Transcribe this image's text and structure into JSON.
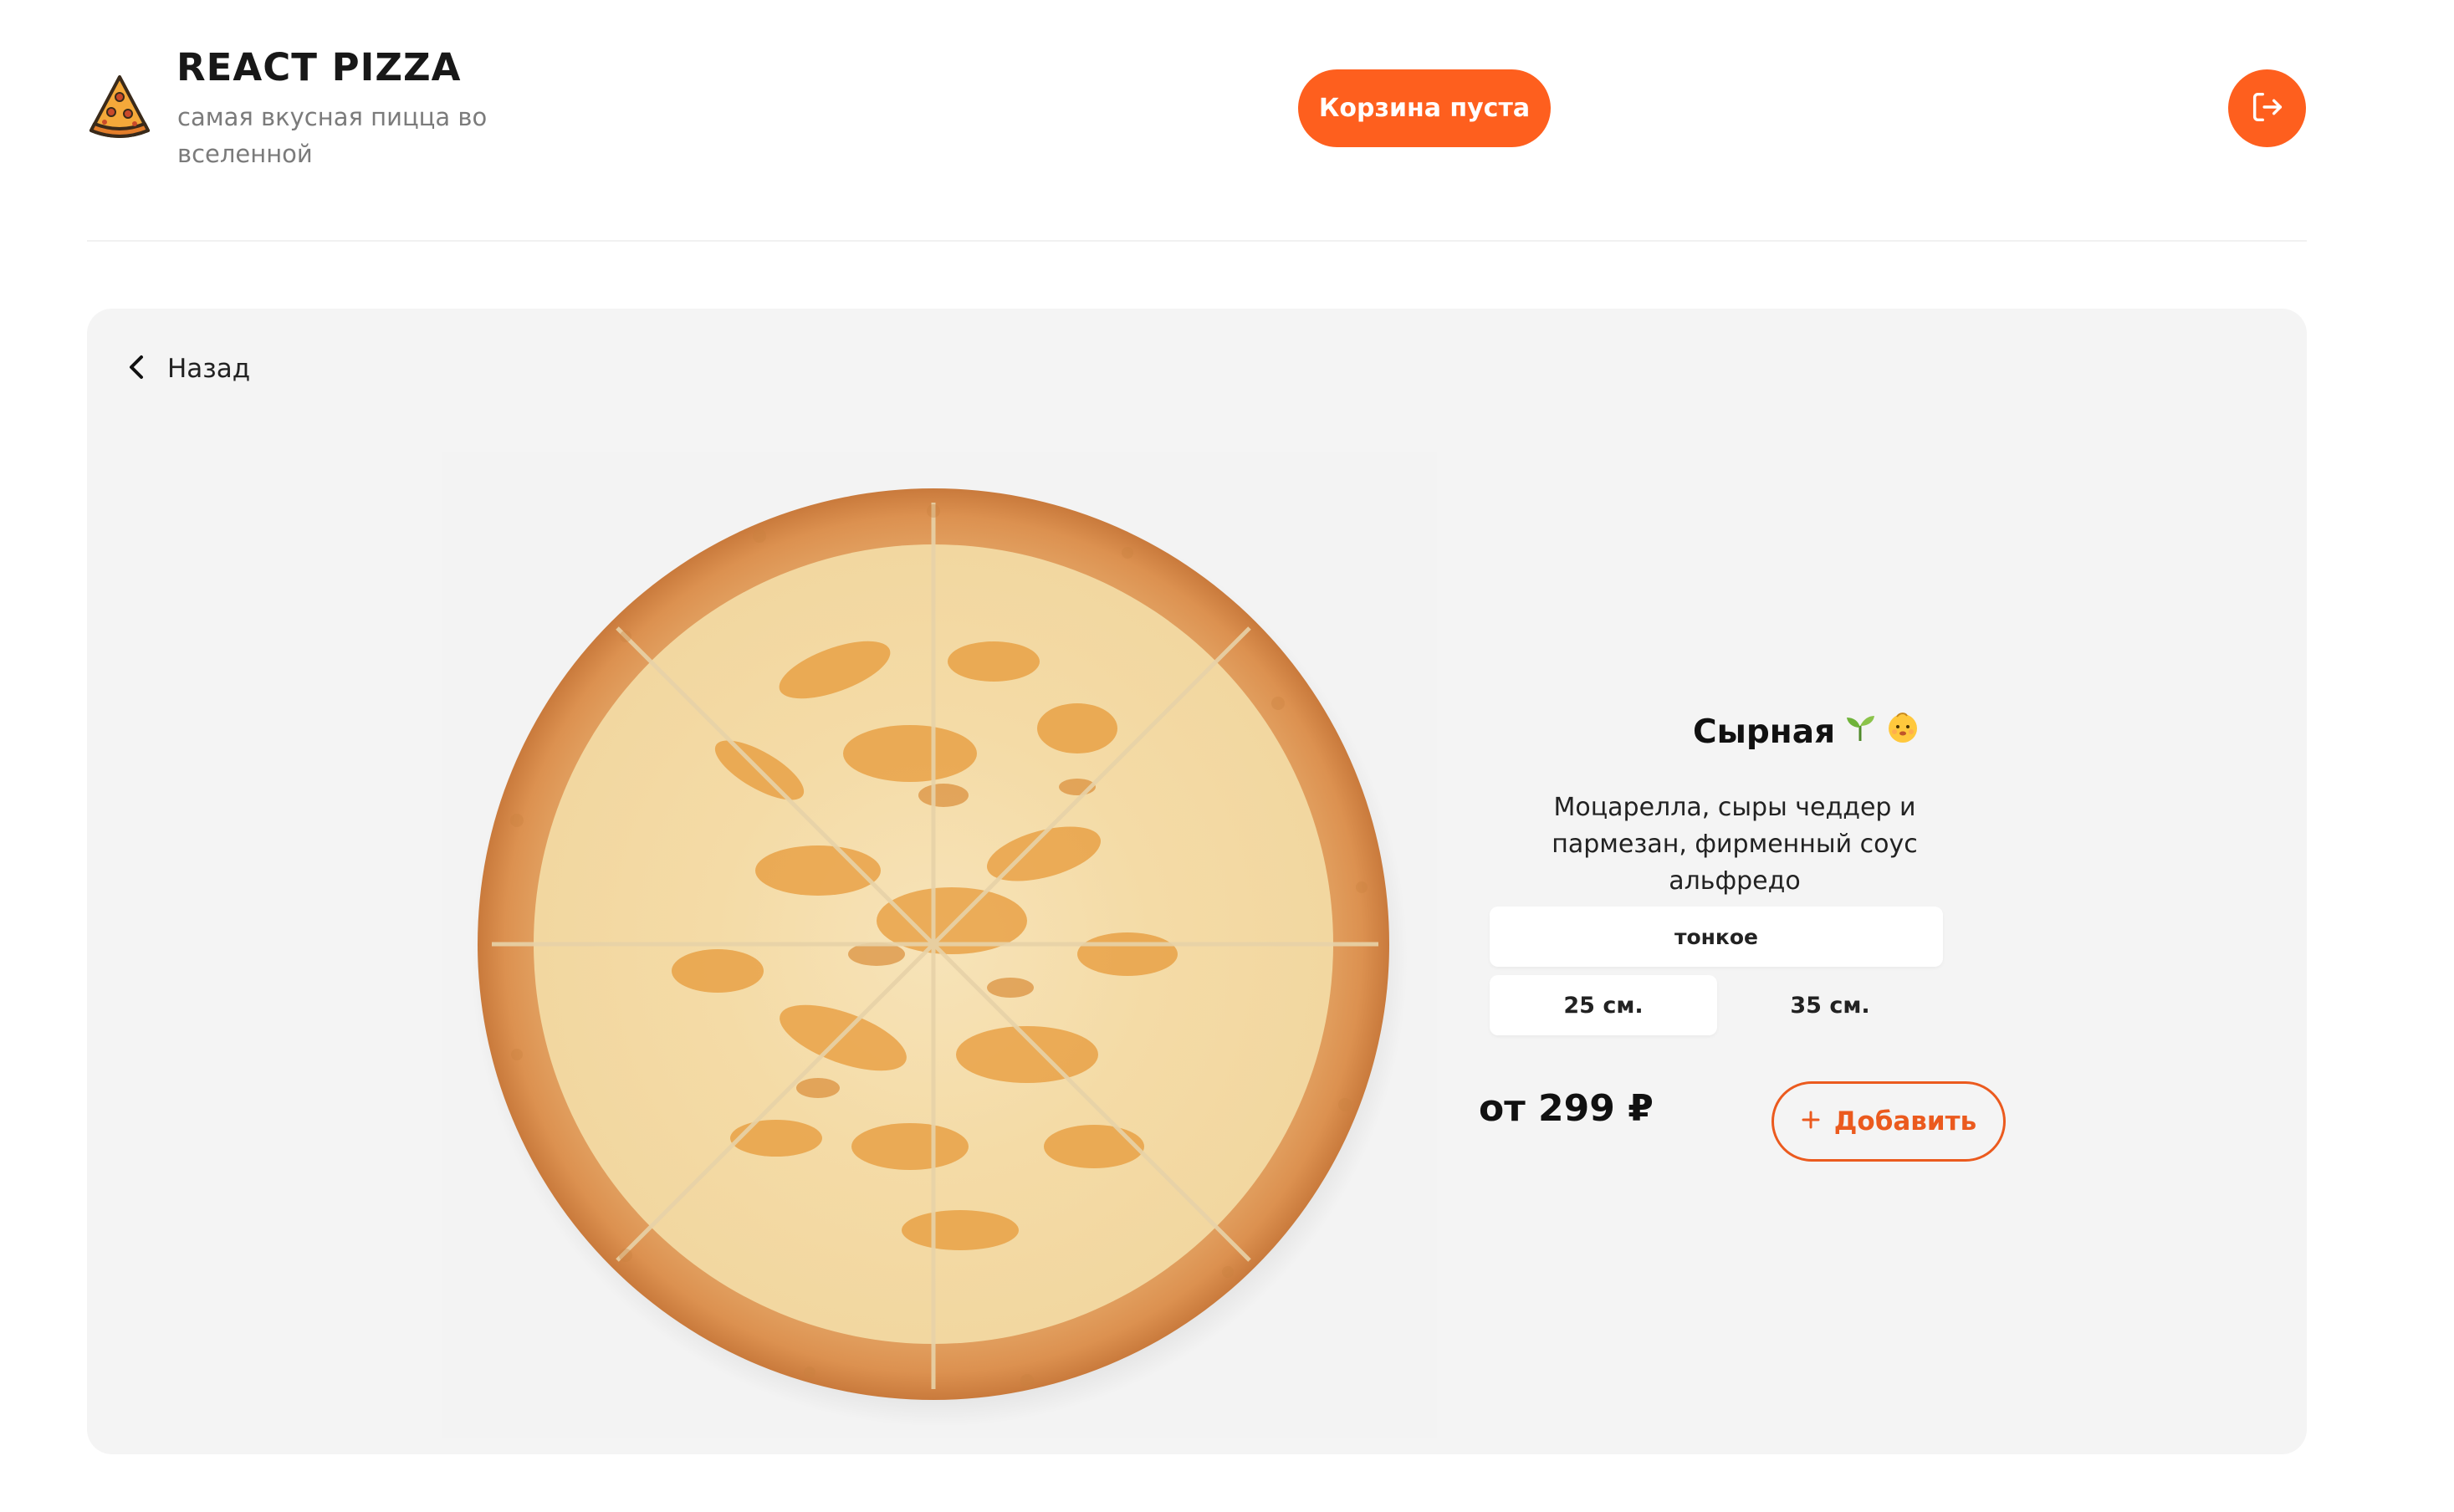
{
  "header": {
    "title": "REACT PIZZA",
    "subtitle": "самая вкусная пицца во вселенной",
    "cart_label": "Корзина пуста",
    "logo_icon": "pizza-slice-icon",
    "logout_icon": "logout-icon"
  },
  "nav": {
    "back_label": "Назад",
    "back_icon": "chevron-left-icon"
  },
  "product": {
    "title": "Сырная",
    "badges": [
      "sprout-icon",
      "baby-face-icon"
    ],
    "description": "Моцарелла, сыры чеддер и пармезан, фирменный соус альфредо",
    "types": [
      {
        "label": "тонкое",
        "selected": true
      }
    ],
    "sizes": [
      {
        "label": "25 см.",
        "selected": true
      },
      {
        "label": "35 см.",
        "selected": false
      }
    ],
    "price": "от 299 ₽",
    "add_label": "Добавить",
    "add_icon": "plus-icon"
  },
  "colors": {
    "accent": "#fe5f1e",
    "card_bg": "#f4f4f4",
    "text": "#111111",
    "muted": "#7b7b7b"
  }
}
